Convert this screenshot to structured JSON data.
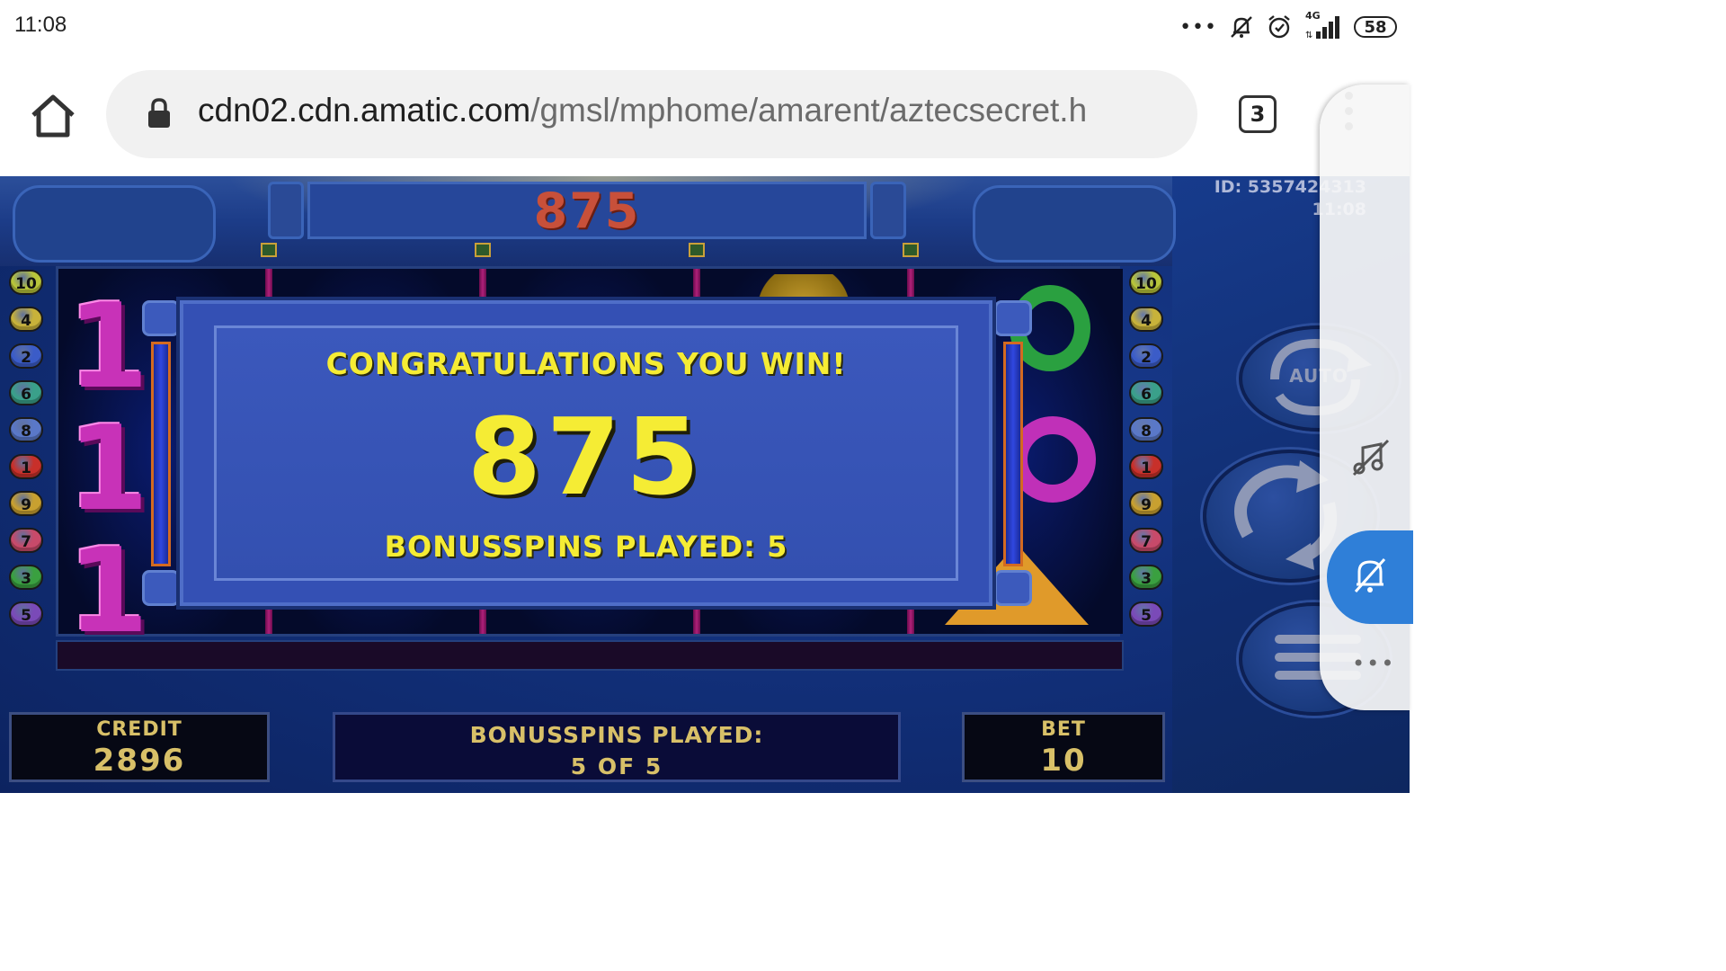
{
  "status_bar": {
    "time": "11:08",
    "more": "•••",
    "network": "4G",
    "battery": "58",
    "icons": [
      "notifications-off-icon",
      "alarm-icon",
      "signal-icon",
      "battery-icon"
    ]
  },
  "browser": {
    "url_host": "cdn02.cdn.amatic.com",
    "url_path": "/gmsl/mphome/amarent/aztecsecret.h",
    "tab_count": "3",
    "icons": [
      "home-icon",
      "lock-icon",
      "tabs-icon",
      "overflow-menu-icon"
    ]
  },
  "game": {
    "top_win": "875",
    "id_label": "ID: 5357424313",
    "id_time": "11:08",
    "line_numbers": [
      "10",
      "4",
      "2",
      "6",
      "8",
      "1",
      "9",
      "7",
      "3",
      "5"
    ],
    "line_colors": [
      "#b8c53a",
      "#c8b23a",
      "#3b5cc8",
      "#3aa08a",
      "#5a78c8",
      "#c8302a",
      "#c8a030",
      "#c84a6a",
      "#3aa040",
      "#7a4ab8"
    ],
    "win_dialog": {
      "heading": "CONGRATULATIONS YOU WIN!",
      "amount": "875",
      "subtext": "BONUSSPINS PLAYED: 5"
    },
    "credit": {
      "label": "CREDIT",
      "value": "2896"
    },
    "bonus": {
      "label": "BONUSSPINS PLAYED:",
      "value": "5 OF 5"
    },
    "bet": {
      "label": "BET",
      "value": "10"
    },
    "auto_label": "AUTO",
    "icons": [
      "auto-spin-icon",
      "spin-icon",
      "menu-lines-icon"
    ]
  },
  "floating_panel": {
    "icons": [
      "music-off-icon",
      "bell-off-icon",
      "more-dots-icon"
    ],
    "dots": "•••"
  },
  "colors": {
    "accent_yellow": "#f5ec34",
    "panel_gold": "#d8c068",
    "game_blue": "#1b3f96",
    "overlay_blue": "#2f7fd8"
  }
}
